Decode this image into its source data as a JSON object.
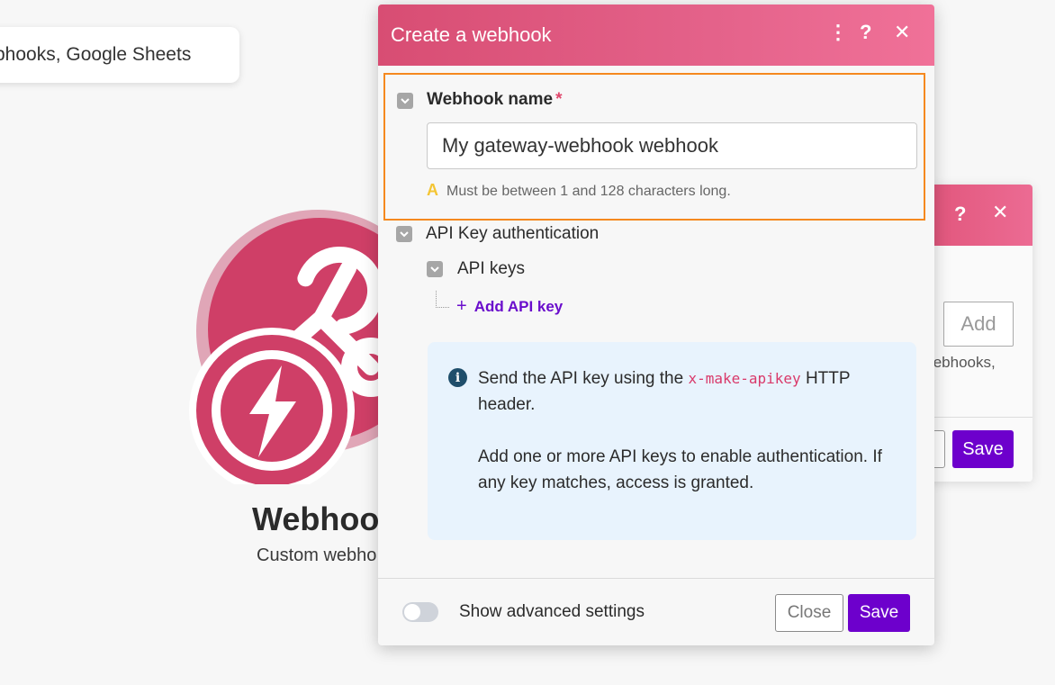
{
  "background": {
    "search_text": "bhooks, Google Sheets",
    "module_title": "Webhoo",
    "module_subtitle": "Custom webho",
    "icons": [
      "webhook-icon",
      "lightning-icon"
    ]
  },
  "back_dialog": {
    "help": "?",
    "close": "✕",
    "add_label": "Add",
    "hint": "/ebhooks,",
    "save_label": "Save"
  },
  "dialog": {
    "title": "Create a webhook",
    "kebab": "⋮",
    "help": "?",
    "close": "✕",
    "webhook_name_label": "Webhook name",
    "required_mark": "*",
    "webhook_name_value": "My gateway-webhook webhook",
    "warning_icon": "A",
    "warning_text": "Must be between 1 and 128 characters long.",
    "api_auth_label": "API Key authentication",
    "api_keys_label": "API keys",
    "add_api_key": "Add API key",
    "info": {
      "p1_before": "Send the API key using the ",
      "p1_code": "x-make-apikey",
      "p1_after": " HTTP header.",
      "p2": "Add one or more API keys to enable authentication. If any key matches, access is granted."
    },
    "advanced_label": "Show advanced settings",
    "advanced_enabled": false,
    "close_label": "Close",
    "save_label": "Save"
  },
  "colors": {
    "header_pink": "#e0547a",
    "accent_purple": "#6d00cc",
    "highlight_orange": "#f5891f"
  }
}
